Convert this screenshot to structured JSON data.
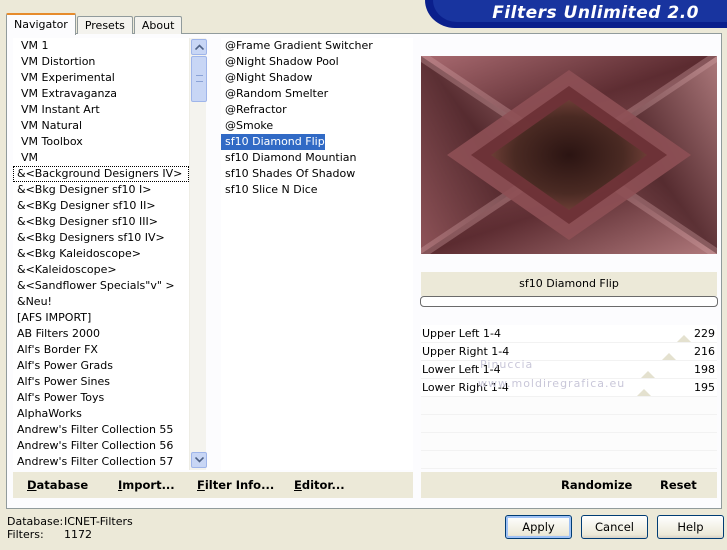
{
  "header": {
    "title": "Filters Unlimited 2.0"
  },
  "tabs": [
    {
      "label": "Navigator",
      "active": true
    },
    {
      "label": "Presets",
      "active": false
    },
    {
      "label": "About",
      "active": false
    }
  ],
  "categories": [
    "VM 1",
    "VM Distortion",
    "VM Experimental",
    "VM Extravaganza",
    "VM Instant Art",
    "VM Natural",
    "VM Toolbox",
    "VM",
    "&<Background Designers IV>",
    "&<Bkg Designer sf10 I>",
    "&<BKg Designer sf10 II>",
    "&<Bkg Designer sf10 III>",
    "&<Bkg Designers sf10 IV>",
    "&<Bkg Kaleidoscope>",
    "&<Kaleidoscope>",
    "&<Sandflower Specials\"v\" >",
    "&Neu!",
    "[AFS IMPORT]",
    "AB Filters 2000",
    "Alf's Border FX",
    "Alf's Power Grads",
    "Alf's Power Sines",
    "Alf's Power Toys",
    "AlphaWorks",
    "Andrew's Filter Collection 55",
    "Andrew's Filter Collection 56",
    "Andrew's Filter Collection 57"
  ],
  "selected_category_index": 8,
  "filters": [
    "@Frame Gradient Switcher",
    "@Night Shadow Pool",
    "@Night Shadow",
    "@Random Smelter",
    "@Refractor",
    "@Smoke",
    "sf10 Diamond Flip",
    "sf10 Diamond Mountian",
    "sf10 Shades Of Shadow",
    "sf10 Slice N Dice"
  ],
  "selected_filter_index": 6,
  "preview": {
    "filter_name": "sf10 Diamond Flip",
    "progress": 0
  },
  "sliders": [
    {
      "label": "Upper Left 1-4",
      "value": 229,
      "max": 255
    },
    {
      "label": "Upper Right 1-4",
      "value": 216,
      "max": 255
    },
    {
      "label": "Lower Left 1-4",
      "value": 198,
      "max": 255
    },
    {
      "label": "Lower Right 1-4",
      "value": 195,
      "max": 255
    }
  ],
  "watermark": {
    "line1": "Pinuccia",
    "line2": "www.moldiregrafica.eu"
  },
  "bottom_left": {
    "database": "Database",
    "import": "Import...",
    "filter_info": "Filter Info...",
    "editor": "Editor..."
  },
  "bottom_right": {
    "randomize": "Randomize",
    "reset": "Reset"
  },
  "status": {
    "database_label": "Database:",
    "database_value": "ICNET-Filters",
    "filters_label": "Filters:",
    "filters_value": "1172"
  },
  "buttons": {
    "apply": "Apply",
    "cancel": "Cancel",
    "help": "Help"
  },
  "colors": {
    "banner": "#18349f",
    "selection": "#316ac5",
    "tab_accent": "#e68b2c"
  }
}
